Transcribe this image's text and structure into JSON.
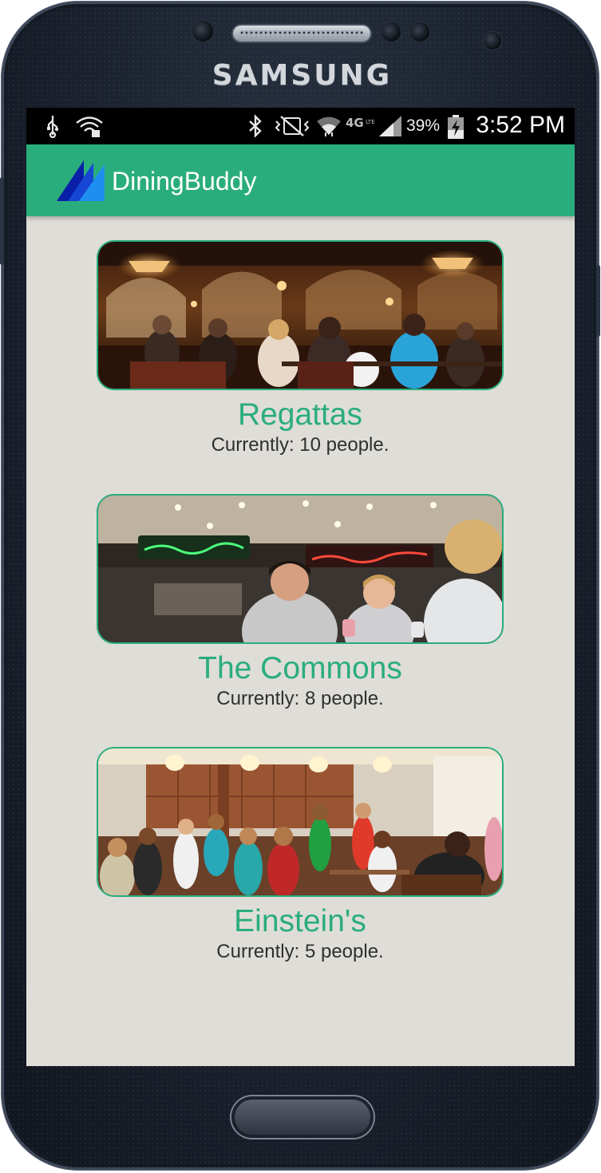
{
  "device": {
    "brand": "SAMSUNG"
  },
  "status_bar": {
    "icons_left": [
      "usb-icon",
      "wifi-hotspot-icon"
    ],
    "icons_right": [
      "bluetooth-icon",
      "vibrate-icon",
      "wifi-icon",
      "4g-lte-icon",
      "signal-icon"
    ],
    "battery_percent": "39%",
    "battery_icon": "battery-charging-icon",
    "time": "3:52 PM"
  },
  "app_bar": {
    "logo_icon": "dining-buddy-logo-icon",
    "title": "DiningBuddy",
    "color": "#2aad7d"
  },
  "dining_halls": [
    {
      "name": "Regattas",
      "count_text": "Currently: 10 people.",
      "image": "photo of students dining in a warmly lit restaurant with arched ceilings"
    },
    {
      "name": "The Commons",
      "count_text": "Currently: 8 people.",
      "image": "photo of students smiling in a food court with neon signs"
    },
    {
      "name": "Einstein's",
      "count_text": "Currently: 5 people.",
      "image": "photo of students in a bright café with wooden tables and hanging lamps"
    }
  ],
  "colors": {
    "accent": "#2aad7d",
    "background": "#dfddd8",
    "text": "#2f2f2f"
  }
}
